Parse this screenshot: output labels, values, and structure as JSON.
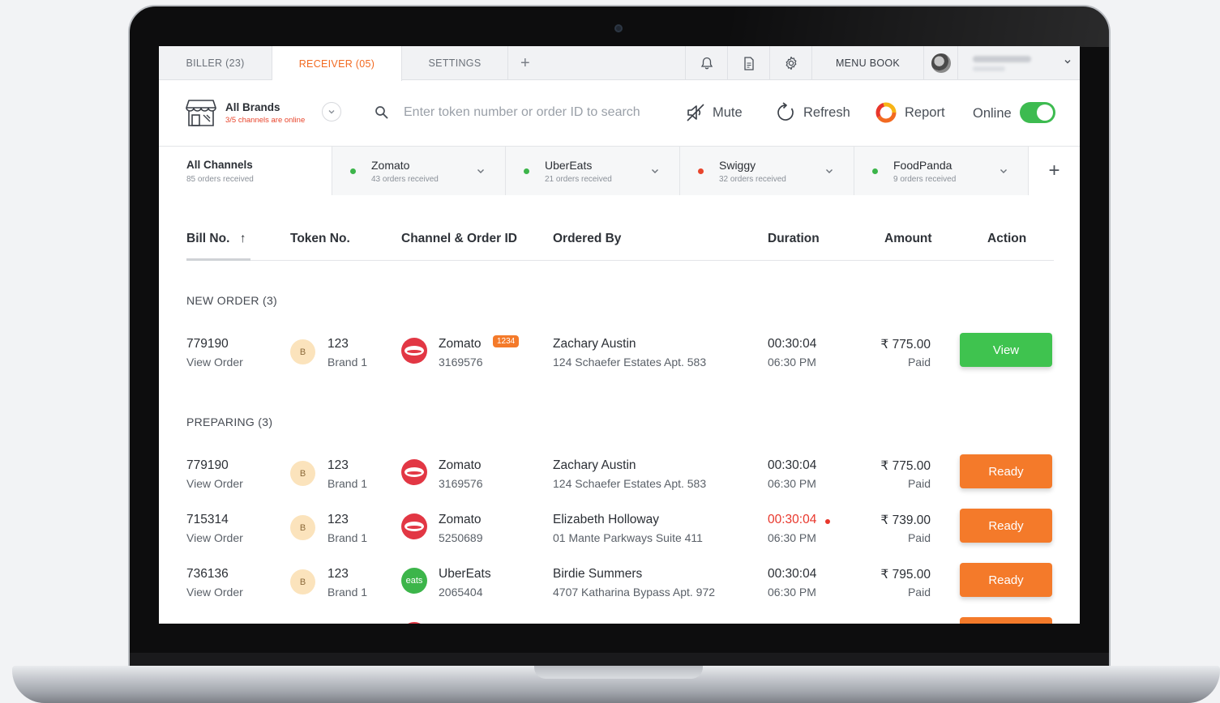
{
  "top_tabs": [
    {
      "label": "BILLER (23)"
    },
    {
      "label": "RECEIVER (05)"
    },
    {
      "label": "SETTINGS"
    },
    {
      "label": "+"
    }
  ],
  "menu_book_label": "MENU BOOK",
  "brand": {
    "name": "All Brands",
    "status": "3/5 channels are online"
  },
  "search": {
    "placeholder": "Enter token number or order ID to search"
  },
  "toolbar": {
    "mute_label": "Mute",
    "refresh_label": "Refresh",
    "report_label": "Report",
    "online_label": "Online",
    "online": true
  },
  "channels": [
    {
      "name": "All Channels",
      "count": "85 orders received"
    },
    {
      "name": "Zomato",
      "count": "43 orders received",
      "status_color": "#3cb54a"
    },
    {
      "name": "UberEats",
      "count": "21 orders received",
      "status_color": "#3cb54a"
    },
    {
      "name": "Swiggy",
      "count": "32 orders received",
      "status_color": "#e8452c"
    },
    {
      "name": "FoodPanda",
      "count": "9 orders received",
      "status_color": "#3cb54a"
    }
  ],
  "table": {
    "headers": [
      "Bill No.",
      "Token No.",
      "Channel & Order ID",
      "Ordered By",
      "Duration",
      "Amount",
      "Action"
    ],
    "sort_indicator": "↑"
  },
  "sections": [
    {
      "title": "NEW ORDER (3)"
    },
    {
      "title": "PREPARING (3)"
    }
  ],
  "rows": [
    {
      "bill": "779190",
      "view": "View Order",
      "badge": "B",
      "token": "123",
      "brand": "Brand 1",
      "channel": "Zomato",
      "order_id": "3169576",
      "tag": "1234",
      "name": "Zachary Austin",
      "address": "124 Schaefer Estates Apt. 583",
      "duration": "00:30:04",
      "time": "06:30 PM",
      "amount": "₹ 775.00",
      "payment": "Paid",
      "action": "View"
    },
    {
      "bill": "779190",
      "view": "View Order",
      "badge": "B",
      "token": "123",
      "brand": "Brand 1",
      "channel": "Zomato",
      "order_id": "3169576",
      "name": "Zachary Austin",
      "address": "124 Schaefer Estates Apt. 583",
      "duration": "00:30:04",
      "time": "06:30 PM",
      "amount": "₹ 775.00",
      "payment": "Paid",
      "action": "Ready"
    },
    {
      "bill": "715314",
      "view": "View Order",
      "badge": "B",
      "token": "123",
      "brand": "Brand 1",
      "channel": "Zomato",
      "order_id": "5250689",
      "name": "Elizabeth Holloway",
      "address": "01 Mante Parkways Suite 411",
      "duration": "00:30:04",
      "time": "06:30 PM",
      "amount": "₹ 739.00",
      "payment": "Paid",
      "action": "Ready"
    },
    {
      "bill": "736136",
      "view": "View Order",
      "badge": "B",
      "token": "123",
      "brand": "Brand 1",
      "channel": "UberEats",
      "logo_text": "eats",
      "order_id": "2065404",
      "name": "Birdie Summers",
      "address": "4707 Katharina Bypass Apt. 972",
      "duration": "00:30:04",
      "time": "06:30 PM",
      "amount": "₹ 795.00",
      "payment": "Paid",
      "action": "Ready"
    }
  ]
}
